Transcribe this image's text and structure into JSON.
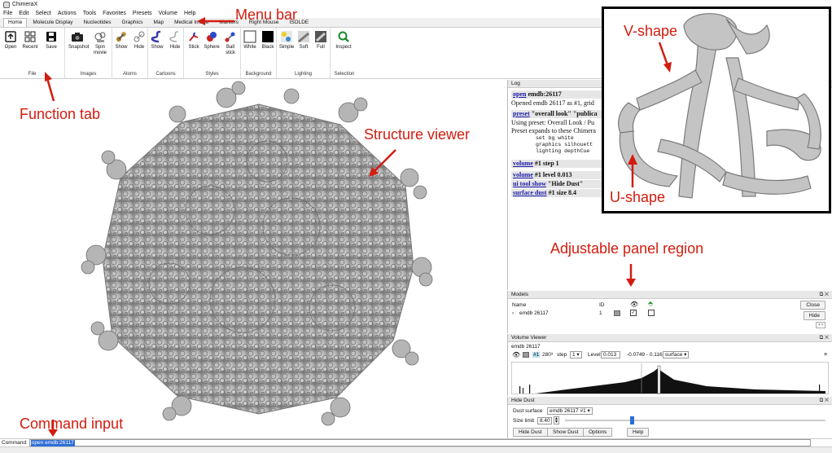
{
  "app": {
    "title": "ChimeraX"
  },
  "menu": [
    "File",
    "Edit",
    "Select",
    "Actions",
    "Tools",
    "Favorites",
    "Presets",
    "Volume",
    "Help"
  ],
  "tabs": [
    "Home",
    "Molecule Display",
    "Nucleotides",
    "Graphics",
    "Map",
    "Medical Image",
    "Markers",
    "Right Mouse",
    "ISOLDE"
  ],
  "ribbon": {
    "file": {
      "label": "File",
      "buttons": [
        "Open",
        "Recent",
        "Save"
      ]
    },
    "images": {
      "label": "Images",
      "buttons": [
        "Snapshot",
        "Spin movie"
      ]
    },
    "atoms": {
      "label": "Atoms",
      "buttons": [
        "Show",
        "Hide"
      ]
    },
    "cartoons": {
      "label": "Cartoons",
      "buttons": [
        "Show",
        "Hide"
      ]
    },
    "styles": {
      "label": "Styles",
      "buttons": [
        "Stick",
        "Sphere",
        "Ball stick"
      ]
    },
    "background": {
      "label": "Background",
      "buttons": [
        "White",
        "Black"
      ]
    },
    "lighting": {
      "label": "Lighting",
      "buttons": [
        "Simple",
        "Soft",
        "Full"
      ]
    },
    "selection": {
      "label": "Selection",
      "buttons": [
        "Inspect"
      ]
    }
  },
  "log": {
    "title": "Log",
    "line1_cmd": "open",
    "line1_arg": " emdb:26117",
    "line2": "Opened emdb 26117 as #1, grid",
    "line3_cmd": "preset",
    "line3_arg": " \"overall look\" \"publica",
    "line4": "Using preset: Overall Look / Pu",
    "line5": "Preset expands to these Chimera",
    "mono1": "set bg white",
    "mono2": "graphics silhouett",
    "mono3": "lighting depthCue",
    "c1_cmd": "volume",
    "c1_arg": " #1 step 1",
    "c2_cmd": "volume",
    "c2_arg": " #1 level 0.013",
    "c3_cmd": "ui tool show",
    "c3_arg": " \"Hide Dust\"",
    "c4_cmd": "surface dust",
    "c4_arg": " #1 size 8.4"
  },
  "models": {
    "title": "Models",
    "col_name": "Name",
    "col_id": "ID",
    "row_name": "emdb 26117",
    "row_id": "1",
    "btn_close": "Close",
    "btn_hide": "Hide"
  },
  "volume": {
    "title": "Volume Viewer",
    "name": "emdb 26117",
    "id": "#1",
    "size": "280³",
    "step_label": "step",
    "step": "1",
    "level_label": "Level",
    "level": "0.013",
    "range": "-0.0749 - 0.116",
    "style": "surface"
  },
  "hidedust": {
    "title": "Hide Dust",
    "surface_label": "Dust surface",
    "surface_value": "emdb 26117 #1",
    "size_label": "Size limit",
    "size_value": "8.40",
    "slider_fraction": 0.25,
    "buttons": [
      "Hide Dust",
      "Show Dust",
      "Options",
      "Help"
    ]
  },
  "command": {
    "label": "Command:",
    "value": "open emdb:26117"
  },
  "annotations": {
    "menu_bar": "Menu bar",
    "function_tab": "Function tab",
    "structure_viewer": "Structure viewer",
    "adjustable_panel": "Adjustable panel region",
    "command_input": "Command input",
    "v_shape": "V-shape",
    "u_shape": "U-shape"
  },
  "colors": {
    "annotation": "#d21c0f",
    "map_surface": "#a9a9a9",
    "link": "#1a1aa8"
  }
}
